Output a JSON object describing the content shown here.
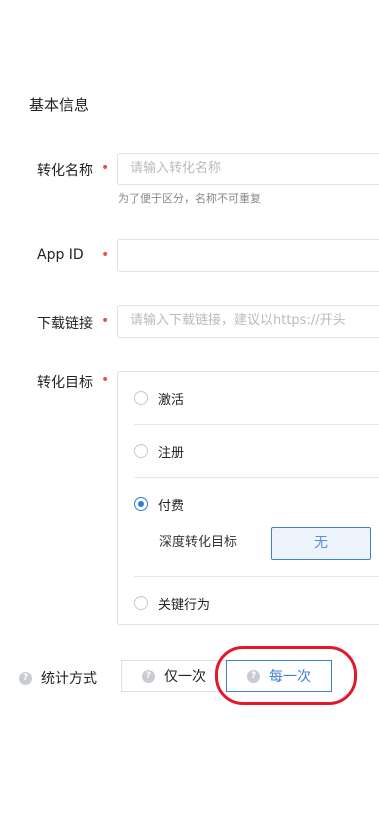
{
  "section": {
    "title": "基本信息"
  },
  "required_mark": "•",
  "fields": {
    "conversion_name": {
      "label": "转化名称",
      "placeholder": "请输入转化名称",
      "hint": "为了便于区分，名称不可重复"
    },
    "app_id": {
      "label": "App ID",
      "value": ""
    },
    "download_link": {
      "label": "下载链接",
      "placeholder": "请输入下载链接，建议以https://开头"
    },
    "conversion_goal": {
      "label": "转化目标",
      "options": [
        {
          "label": "激活",
          "selected": false
        },
        {
          "label": "注册",
          "selected": false
        },
        {
          "label": "付费",
          "selected": true
        },
        {
          "label": "关键行为",
          "selected": false
        }
      ],
      "deep_goal": {
        "label": "深度转化目标",
        "value": "无"
      }
    }
  },
  "statistics": {
    "label": "统计方式",
    "help_icon": "?",
    "options": [
      {
        "label": "仅一次",
        "selected": false
      },
      {
        "label": "每一次",
        "selected": true
      }
    ]
  },
  "colors": {
    "accent": "#3e7fd6",
    "required": "#e8524b",
    "annotation": "#e2192b"
  }
}
